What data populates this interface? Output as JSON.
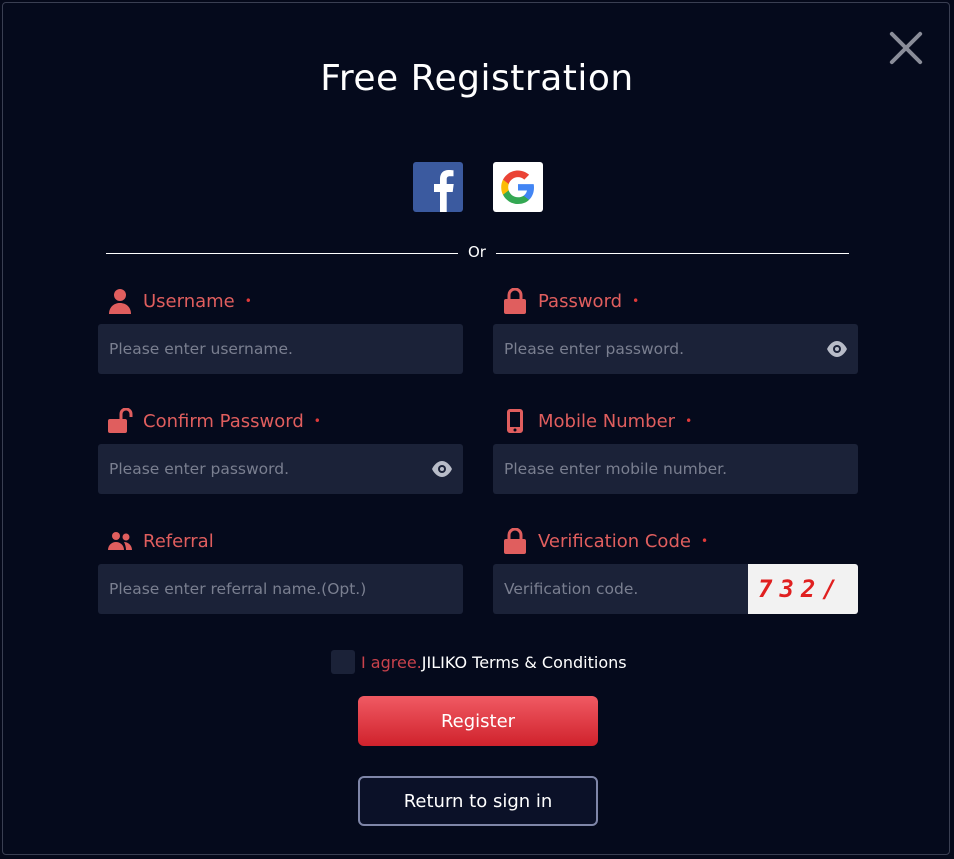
{
  "modal": {
    "title": "Free Registration",
    "divider_text": "Or",
    "social": [
      {
        "name": "facebook-icon"
      },
      {
        "name": "google-icon"
      }
    ]
  },
  "form": {
    "username": {
      "label": "Username",
      "placeholder": "Please enter username.",
      "required": "•"
    },
    "password": {
      "label": "Password",
      "placeholder": "Please enter password.",
      "required": "•"
    },
    "confirm_password": {
      "label": "Confirm Password",
      "placeholder": "Please enter password.",
      "required": "•"
    },
    "mobile": {
      "label": "Mobile Number",
      "placeholder": "Please enter mobile number.",
      "required": "•"
    },
    "referral": {
      "label": "Referral",
      "placeholder": "Please enter referral name.(Opt.)"
    },
    "verification": {
      "label": "Verification Code",
      "placeholder": "Verification code.",
      "required": "•",
      "captcha": "732/"
    }
  },
  "agree": {
    "prefix": "I agree.",
    "terms": "JILIKO Terms & Conditions"
  },
  "buttons": {
    "register": "Register",
    "return": "Return to sign in"
  },
  "colors": {
    "accent": "#e05e5e",
    "background": "#050a1c",
    "field": "#1b2238"
  }
}
